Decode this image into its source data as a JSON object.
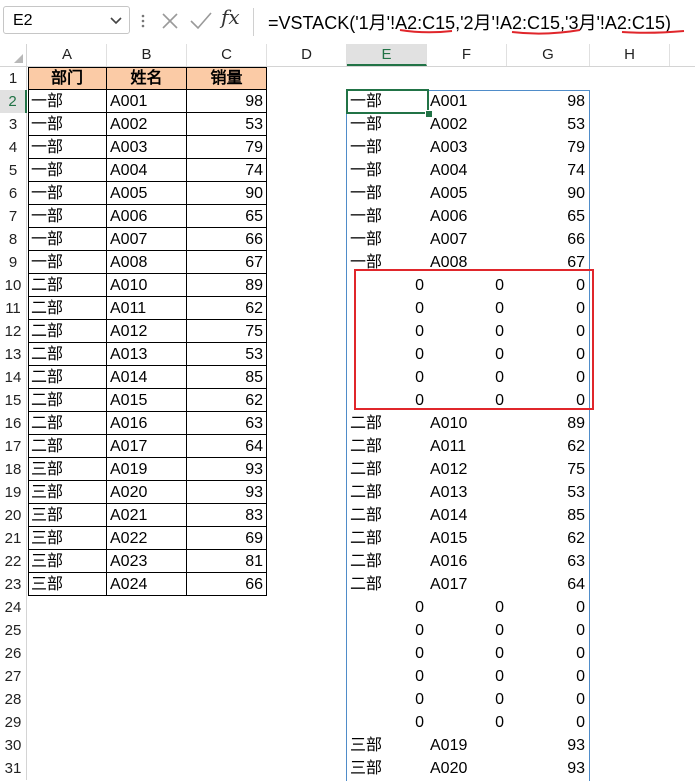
{
  "name_box": {
    "value": "E2"
  },
  "formula_bar": {
    "formula": "=VSTACK('1月'!A2:C15,'2月'!A2:C15,'3月'!A2:C15)"
  },
  "columns": [
    "A",
    "B",
    "C",
    "D",
    "E",
    "F",
    "G",
    "H"
  ],
  "rows": [
    "1",
    "2",
    "3",
    "4",
    "5",
    "6",
    "7",
    "8",
    "9",
    "10",
    "11",
    "12",
    "13",
    "14",
    "15",
    "16",
    "17",
    "18",
    "19",
    "20",
    "21",
    "22",
    "23",
    "24",
    "25",
    "26",
    "27",
    "28",
    "29",
    "30",
    "31"
  ],
  "source_table": {
    "headers": [
      "部门",
      "姓名",
      "销量"
    ],
    "rows": [
      [
        "一部",
        "A001",
        "98"
      ],
      [
        "一部",
        "A002",
        "53"
      ],
      [
        "一部",
        "A003",
        "79"
      ],
      [
        "一部",
        "A004",
        "74"
      ],
      [
        "一部",
        "A005",
        "90"
      ],
      [
        "一部",
        "A006",
        "65"
      ],
      [
        "一部",
        "A007",
        "66"
      ],
      [
        "一部",
        "A008",
        "67"
      ],
      [
        "二部",
        "A010",
        "89"
      ],
      [
        "二部",
        "A011",
        "62"
      ],
      [
        "二部",
        "A012",
        "75"
      ],
      [
        "二部",
        "A013",
        "53"
      ],
      [
        "二部",
        "A014",
        "85"
      ],
      [
        "二部",
        "A015",
        "62"
      ],
      [
        "二部",
        "A016",
        "63"
      ],
      [
        "二部",
        "A017",
        "64"
      ],
      [
        "三部",
        "A019",
        "93"
      ],
      [
        "三部",
        "A020",
        "93"
      ],
      [
        "三部",
        "A021",
        "83"
      ],
      [
        "三部",
        "A022",
        "69"
      ],
      [
        "三部",
        "A023",
        "81"
      ],
      [
        "三部",
        "A024",
        "66"
      ]
    ]
  },
  "spill_result": {
    "rows": [
      [
        "一部",
        "A001",
        "98"
      ],
      [
        "一部",
        "A002",
        "53"
      ],
      [
        "一部",
        "A003",
        "79"
      ],
      [
        "一部",
        "A004",
        "74"
      ],
      [
        "一部",
        "A005",
        "90"
      ],
      [
        "一部",
        "A006",
        "65"
      ],
      [
        "一部",
        "A007",
        "66"
      ],
      [
        "一部",
        "A008",
        "67"
      ],
      [
        "0",
        "0",
        "0"
      ],
      [
        "0",
        "0",
        "0"
      ],
      [
        "0",
        "0",
        "0"
      ],
      [
        "0",
        "0",
        "0"
      ],
      [
        "0",
        "0",
        "0"
      ],
      [
        "0",
        "0",
        "0"
      ],
      [
        "二部",
        "A010",
        "89"
      ],
      [
        "二部",
        "A011",
        "62"
      ],
      [
        "二部",
        "A012",
        "75"
      ],
      [
        "二部",
        "A013",
        "53"
      ],
      [
        "二部",
        "A014",
        "85"
      ],
      [
        "二部",
        "A015",
        "62"
      ],
      [
        "二部",
        "A016",
        "63"
      ],
      [
        "二部",
        "A017",
        "64"
      ],
      [
        "0",
        "0",
        "0"
      ],
      [
        "0",
        "0",
        "0"
      ],
      [
        "0",
        "0",
        "0"
      ],
      [
        "0",
        "0",
        "0"
      ],
      [
        "0",
        "0",
        "0"
      ],
      [
        "0",
        "0",
        "0"
      ],
      [
        "三部",
        "A019",
        "93"
      ],
      [
        "三部",
        "A020",
        "93"
      ]
    ]
  },
  "colors": {
    "header_fill": "#fbcba6",
    "selection": "#217346",
    "annotation_red": "#e0262b",
    "spill_border": "#4f8cc9"
  },
  "icons": {
    "name_box_dropdown": "chevron-down-icon",
    "cancel": "close-icon",
    "enter": "check-icon",
    "function": "fx-icon"
  }
}
